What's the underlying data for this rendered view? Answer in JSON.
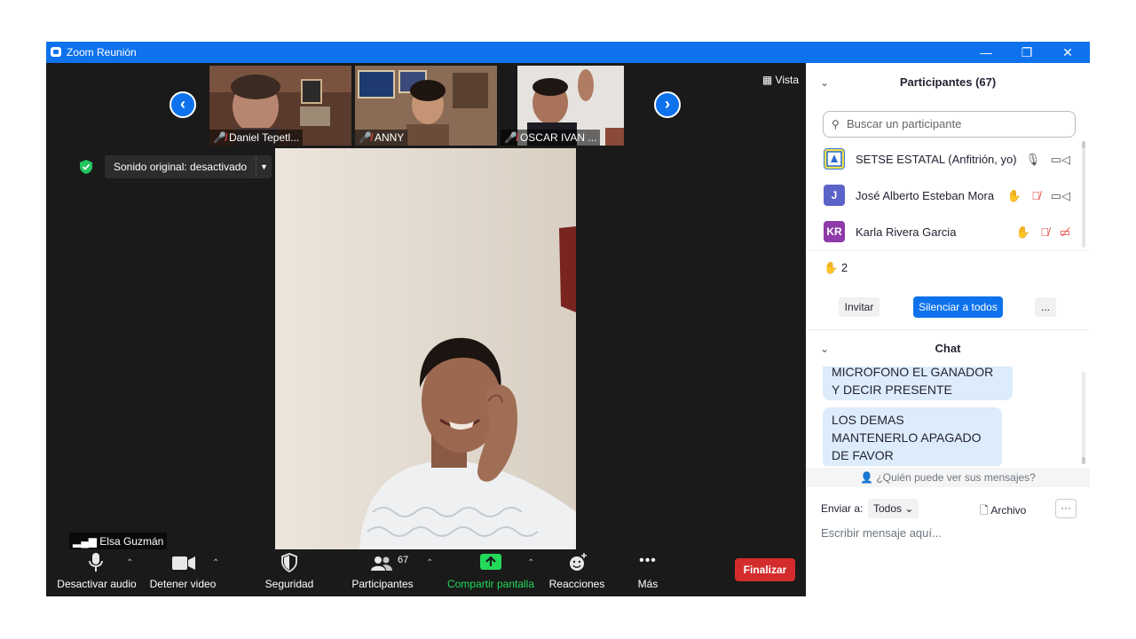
{
  "window": {
    "title": "Zoom Reunión",
    "controls": {
      "minimize": "—",
      "restore": "❐",
      "close": "✕"
    }
  },
  "gallery": {
    "view_label": "Vista",
    "thumbnails": [
      {
        "name": "Daniel Tepetl...",
        "muted": true
      },
      {
        "name": "ANNY",
        "muted": true
      },
      {
        "name": "OSCAR IVAN ...",
        "muted": true
      }
    ]
  },
  "audio_notice": {
    "label": "Sonido original: desactivado"
  },
  "speaker": {
    "name": "Elsa Guzmán"
  },
  "toolbar": {
    "mute": "Desactivar audio",
    "video": "Detener video",
    "security": "Seguridad",
    "participants": "Participantes",
    "participants_count": "67",
    "share": "Compartir pantalla",
    "reactions": "Reacciones",
    "more": "Más",
    "end": "Finalizar"
  },
  "participants_panel": {
    "title": "Participantes (67)",
    "search_placeholder": "Buscar un participante",
    "rows": [
      {
        "initials": "",
        "name": "SETSE ESTATAL (Anfitrión, yo)",
        "color": "#f4e04d",
        "hand": false,
        "mic_muted": false,
        "video_off": false
      },
      {
        "initials": "J",
        "name": "José Alberto Esteban Mora",
        "color": "#5b63c8",
        "hand": true,
        "mic_muted": true,
        "video_off": false
      },
      {
        "initials": "KR",
        "name": "Karla Rivera Garcia",
        "color": "#8e3aa8",
        "hand": true,
        "mic_muted": true,
        "video_off": true
      }
    ],
    "raised_hands": "2",
    "invite": "Invitar",
    "mute_all": "Silenciar a todos",
    "more": "..."
  },
  "chat": {
    "title": "Chat",
    "messages": [
      "MICRÓFONO EL GANADOR Y DECIR PRESENTE",
      "LOS DEMAS MANTENERLO APAGADO DE FAVOR"
    ],
    "who_can_see": "¿Quién puede ver sus mensajes?",
    "send_to_label": "Enviar a:",
    "send_to_value": "Todos",
    "file_label": "Archivo",
    "input_placeholder": "Escribir mensaje aquí..."
  },
  "colors": {
    "accent": "#0e72ed",
    "end_button": "#d42c2c",
    "share_green": "#23d959",
    "muted_red": "#e03e3e",
    "hand_yellow": "#f5b82e"
  }
}
